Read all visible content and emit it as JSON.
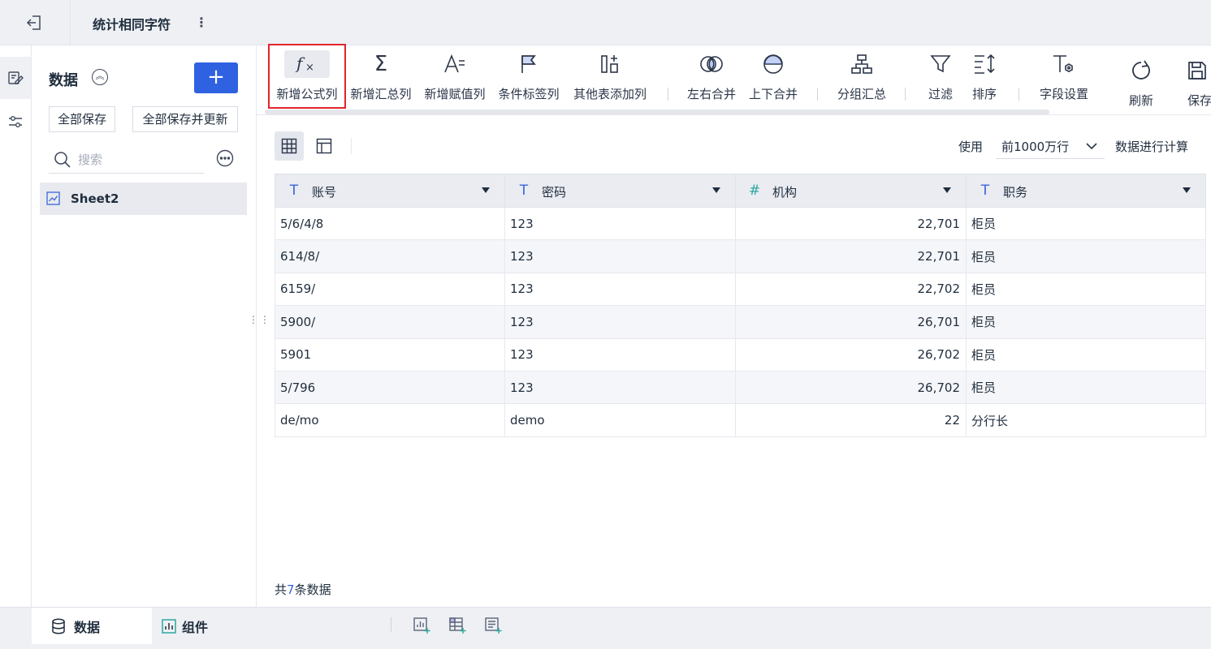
{
  "topbar": {
    "title": "统计相同字符",
    "exit_icon": "exit-icon",
    "more_icon": "more-vertical-icon"
  },
  "rail": {
    "items": [
      {
        "name": "data-edit-icon",
        "active": true
      },
      {
        "name": "filter-settings-icon",
        "active": false
      }
    ]
  },
  "panel": {
    "title": "数据",
    "add_label": "+",
    "save_all_label": "全部保存",
    "save_all_update_label": "全部保存并更新",
    "search_placeholder": "搜索",
    "sheet_name": "Sheet2"
  },
  "toolbar": {
    "items": [
      {
        "label": "新增公式列",
        "icon": "formula-icon",
        "highlighted": true
      },
      {
        "label": "新增汇总列",
        "icon": "sigma-icon"
      },
      {
        "label": "新增赋值列",
        "icon": "assign-icon"
      },
      {
        "label": "条件标签列",
        "icon": "flag-icon"
      },
      {
        "label": "其他表添加列",
        "icon": "add-column-icon"
      },
      {
        "label": "左右合并",
        "icon": "horizontal-merge-icon"
      },
      {
        "label": "上下合并",
        "icon": "vertical-merge-icon"
      },
      {
        "label": "分组汇总",
        "icon": "group-icon"
      },
      {
        "label": "过滤",
        "icon": "filter-icon"
      },
      {
        "label": "排序",
        "icon": "sort-icon"
      },
      {
        "label": "字段设置",
        "icon": "field-settings-icon"
      },
      {
        "label": "刷新",
        "icon": "refresh-icon"
      },
      {
        "label": "保存",
        "icon": "save-icon"
      }
    ]
  },
  "calc": {
    "prefix": "使用",
    "value": "前1000万行",
    "suffix": "数据进行计算"
  },
  "table": {
    "columns": [
      {
        "type": "T",
        "name": "账号"
      },
      {
        "type": "T",
        "name": "密码"
      },
      {
        "type": "#",
        "name": "机构"
      },
      {
        "type": "T",
        "name": "职务"
      }
    ],
    "rows": [
      [
        "5/6/4/8",
        "123",
        "22,701",
        "柜员"
      ],
      [
        "614/8/",
        "123",
        "22,701",
        "柜员"
      ],
      [
        "6159/",
        "123",
        "22,702",
        "柜员"
      ],
      [
        "5900/",
        "123",
        "26,701",
        "柜员"
      ],
      [
        "5901",
        "123",
        "26,702",
        "柜员"
      ],
      [
        "5/796",
        "123",
        "26,702",
        "柜员"
      ],
      [
        "de/mo",
        "demo",
        "22",
        "分行长"
      ]
    ]
  },
  "footer": {
    "prefix": "共",
    "count": "7",
    "suffix": "条数据"
  },
  "bottom": {
    "tabs": [
      {
        "label": "数据",
        "icon": "database-icon",
        "active": true
      },
      {
        "label": "组件",
        "icon": "chart-icon",
        "active": false
      }
    ],
    "actions": [
      "add-chart-icon",
      "add-table-icon",
      "add-report-icon"
    ]
  },
  "colors": {
    "accent": "#2f62e0",
    "highlight": "#e0252a",
    "header_bg": "#eaecf2"
  }
}
